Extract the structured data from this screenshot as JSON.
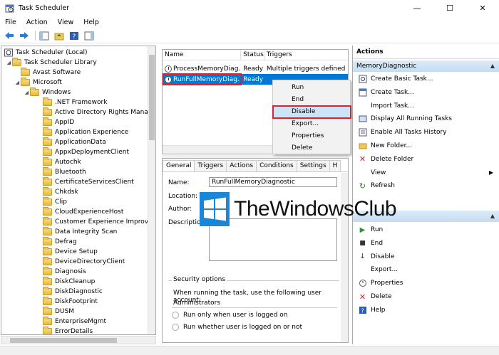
{
  "window": {
    "title": "Task Scheduler"
  },
  "menu": [
    "File",
    "Action",
    "View",
    "Help"
  ],
  "tree": {
    "root": "Task Scheduler (Local)",
    "library": "Task Scheduler Library",
    "items": [
      "Avast Software",
      "Microsoft",
      "Windows",
      ".NET Framework",
      "Active Directory Rights Manag",
      "AppID",
      "Application Experience",
      "ApplicationData",
      "AppxDeploymentClient",
      "Autochk",
      "Bluetooth",
      "CertificateServicesClient",
      "Chkdsk",
      "Clip",
      "CloudExperienceHost",
      "Customer Experience Improver",
      "Data Integrity Scan",
      "Defrag",
      "Device Setup",
      "DeviceDirectoryClient",
      "Diagnosis",
      "DiskCleanup",
      "DiskDiagnostic",
      "DiskFootprint",
      "DUSM",
      "EnterpriseMgmt",
      "ErrorDetails"
    ]
  },
  "tasklist": {
    "columns": [
      "Name",
      "Status",
      "Triggers"
    ],
    "rows": [
      {
        "name": "ProcessMemoryDiag...",
        "status": "Ready",
        "triggers": "Multiple triggers defined"
      },
      {
        "name": "RunFullMemoryDiag...",
        "status": "Ready",
        "triggers": ""
      }
    ]
  },
  "context_menu": [
    "Run",
    "End",
    "Disable",
    "Export...",
    "Properties",
    "Delete"
  ],
  "props": {
    "tabs": [
      "General",
      "Triggers",
      "Actions",
      "Conditions",
      "Settings",
      "H"
    ],
    "name_label": "Name:",
    "name_value": "RunFullMemoryDiagnostic",
    "location_label": "Location:",
    "author_label": "Author:",
    "description_label": "Description",
    "security_title": "Security options",
    "security_text": "When running the task, use the following user account:",
    "account": "Administrators",
    "radio1": "Run only when user is logged on",
    "radio2": "Run whether user is logged on or not"
  },
  "actions": {
    "header": "Actions",
    "section1": "MemoryDiagnostic",
    "items1": [
      "Create Basic Task...",
      "Create Task...",
      "Import Task...",
      "Display All Running Tasks",
      "Enable All Tasks History",
      "New Folder...",
      "Delete Folder",
      "View",
      "Refresh"
    ],
    "items2": [
      "Run",
      "End",
      "Disable",
      "Export...",
      "Properties",
      "Delete",
      "Help"
    ]
  },
  "watermark": "TheWindowsClub",
  "colors": {
    "selection": "#0078d7",
    "highlight_outline": "#d9232e",
    "section": "#c4dcf2"
  }
}
